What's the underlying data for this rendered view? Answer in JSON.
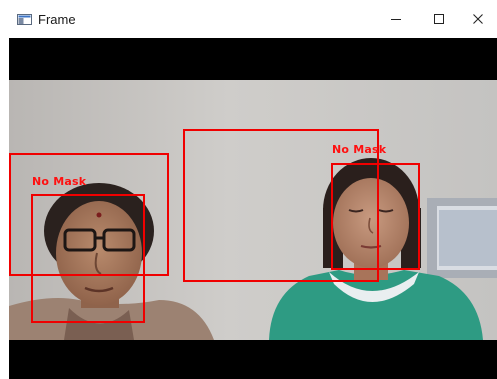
{
  "window": {
    "title": "Frame",
    "icon": "window-app-icon",
    "controls": {
      "minimize": "—",
      "maximize": "☐",
      "close": "✕"
    }
  },
  "detections": [
    {
      "label": "No Mask",
      "color": "#f00000"
    },
    {
      "label": "No Mask",
      "color": "#f00000"
    }
  ]
}
